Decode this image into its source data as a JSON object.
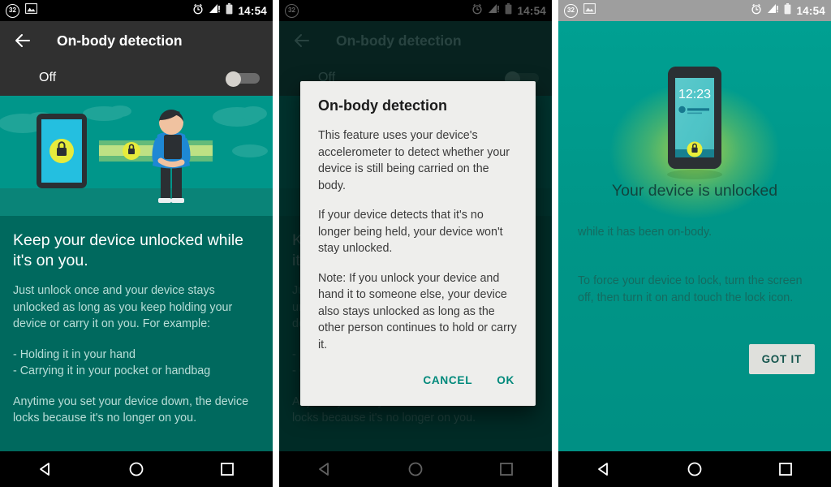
{
  "statusbar": {
    "notif_count": "32",
    "screenshot_icon": "image-icon",
    "alarm_icon": "alarm-clock-icon",
    "signal_icon": "signal-bars-icon",
    "battery_icon": "battery-icon",
    "time": "14:54"
  },
  "navbar": {
    "back": "back-triangle-icon",
    "home": "home-circle-icon",
    "recents": "recents-square-icon"
  },
  "panel1": {
    "appbar": {
      "back_icon": "back-arrow-icon",
      "title": "On-body detection"
    },
    "toggle": {
      "label": "Off",
      "state": "off"
    },
    "illustration": {
      "name": "on-body-detection-illustration",
      "tablet_lock_icon": "lock-icon",
      "beam_lock_icon": "lock-icon",
      "person": "person-holding-phone"
    },
    "heading": "Keep your device unlocked while it's on you.",
    "paragraph1": "Just unlock once and your device stays unlocked as long as you keep holding your device or carry it on you. For example:",
    "bullet1": "- Holding it in your hand",
    "bullet2": "- Carrying it in your pocket or handbag",
    "paragraph2": "Anytime you set your device down, the device locks because it's no longer on you."
  },
  "panel2": {
    "dialog": {
      "title": "On-body detection",
      "paragraph1": "This feature uses your device's accelerometer to detect whether your device is still being carried on the body.",
      "paragraph2": "If your device detects that it's no longer being held, your device won't stay unlocked.",
      "paragraph3": "Note: If you unlock your device and hand it to someone else, your device also stays unlocked as long as the other person continues to hold or carry it.",
      "cancel_label": "CANCEL",
      "ok_label": "OK"
    }
  },
  "panel3": {
    "phone": {
      "name": "unlocked-phone-illustration",
      "clock": "12:23",
      "lock_icon": "lock-icon"
    },
    "heading": "Your device is unlocked",
    "subheading": "while it has been on-body.",
    "paragraph": "To force your device to lock, turn the screen off, then turn it on and touch the lock icon.",
    "got_it_label": "GOT IT"
  },
  "colors": {
    "teal_primary": "#009688",
    "teal_dark": "#00695e",
    "teal_hero": "#00968a",
    "accent_button": "#00897b",
    "statusbar_dark": "#000000",
    "statusbar_grey": "#9e9e9e",
    "appbar": "#303030",
    "dialog_bg": "#eeeeec",
    "lock_yellow": "#e8e832"
  }
}
